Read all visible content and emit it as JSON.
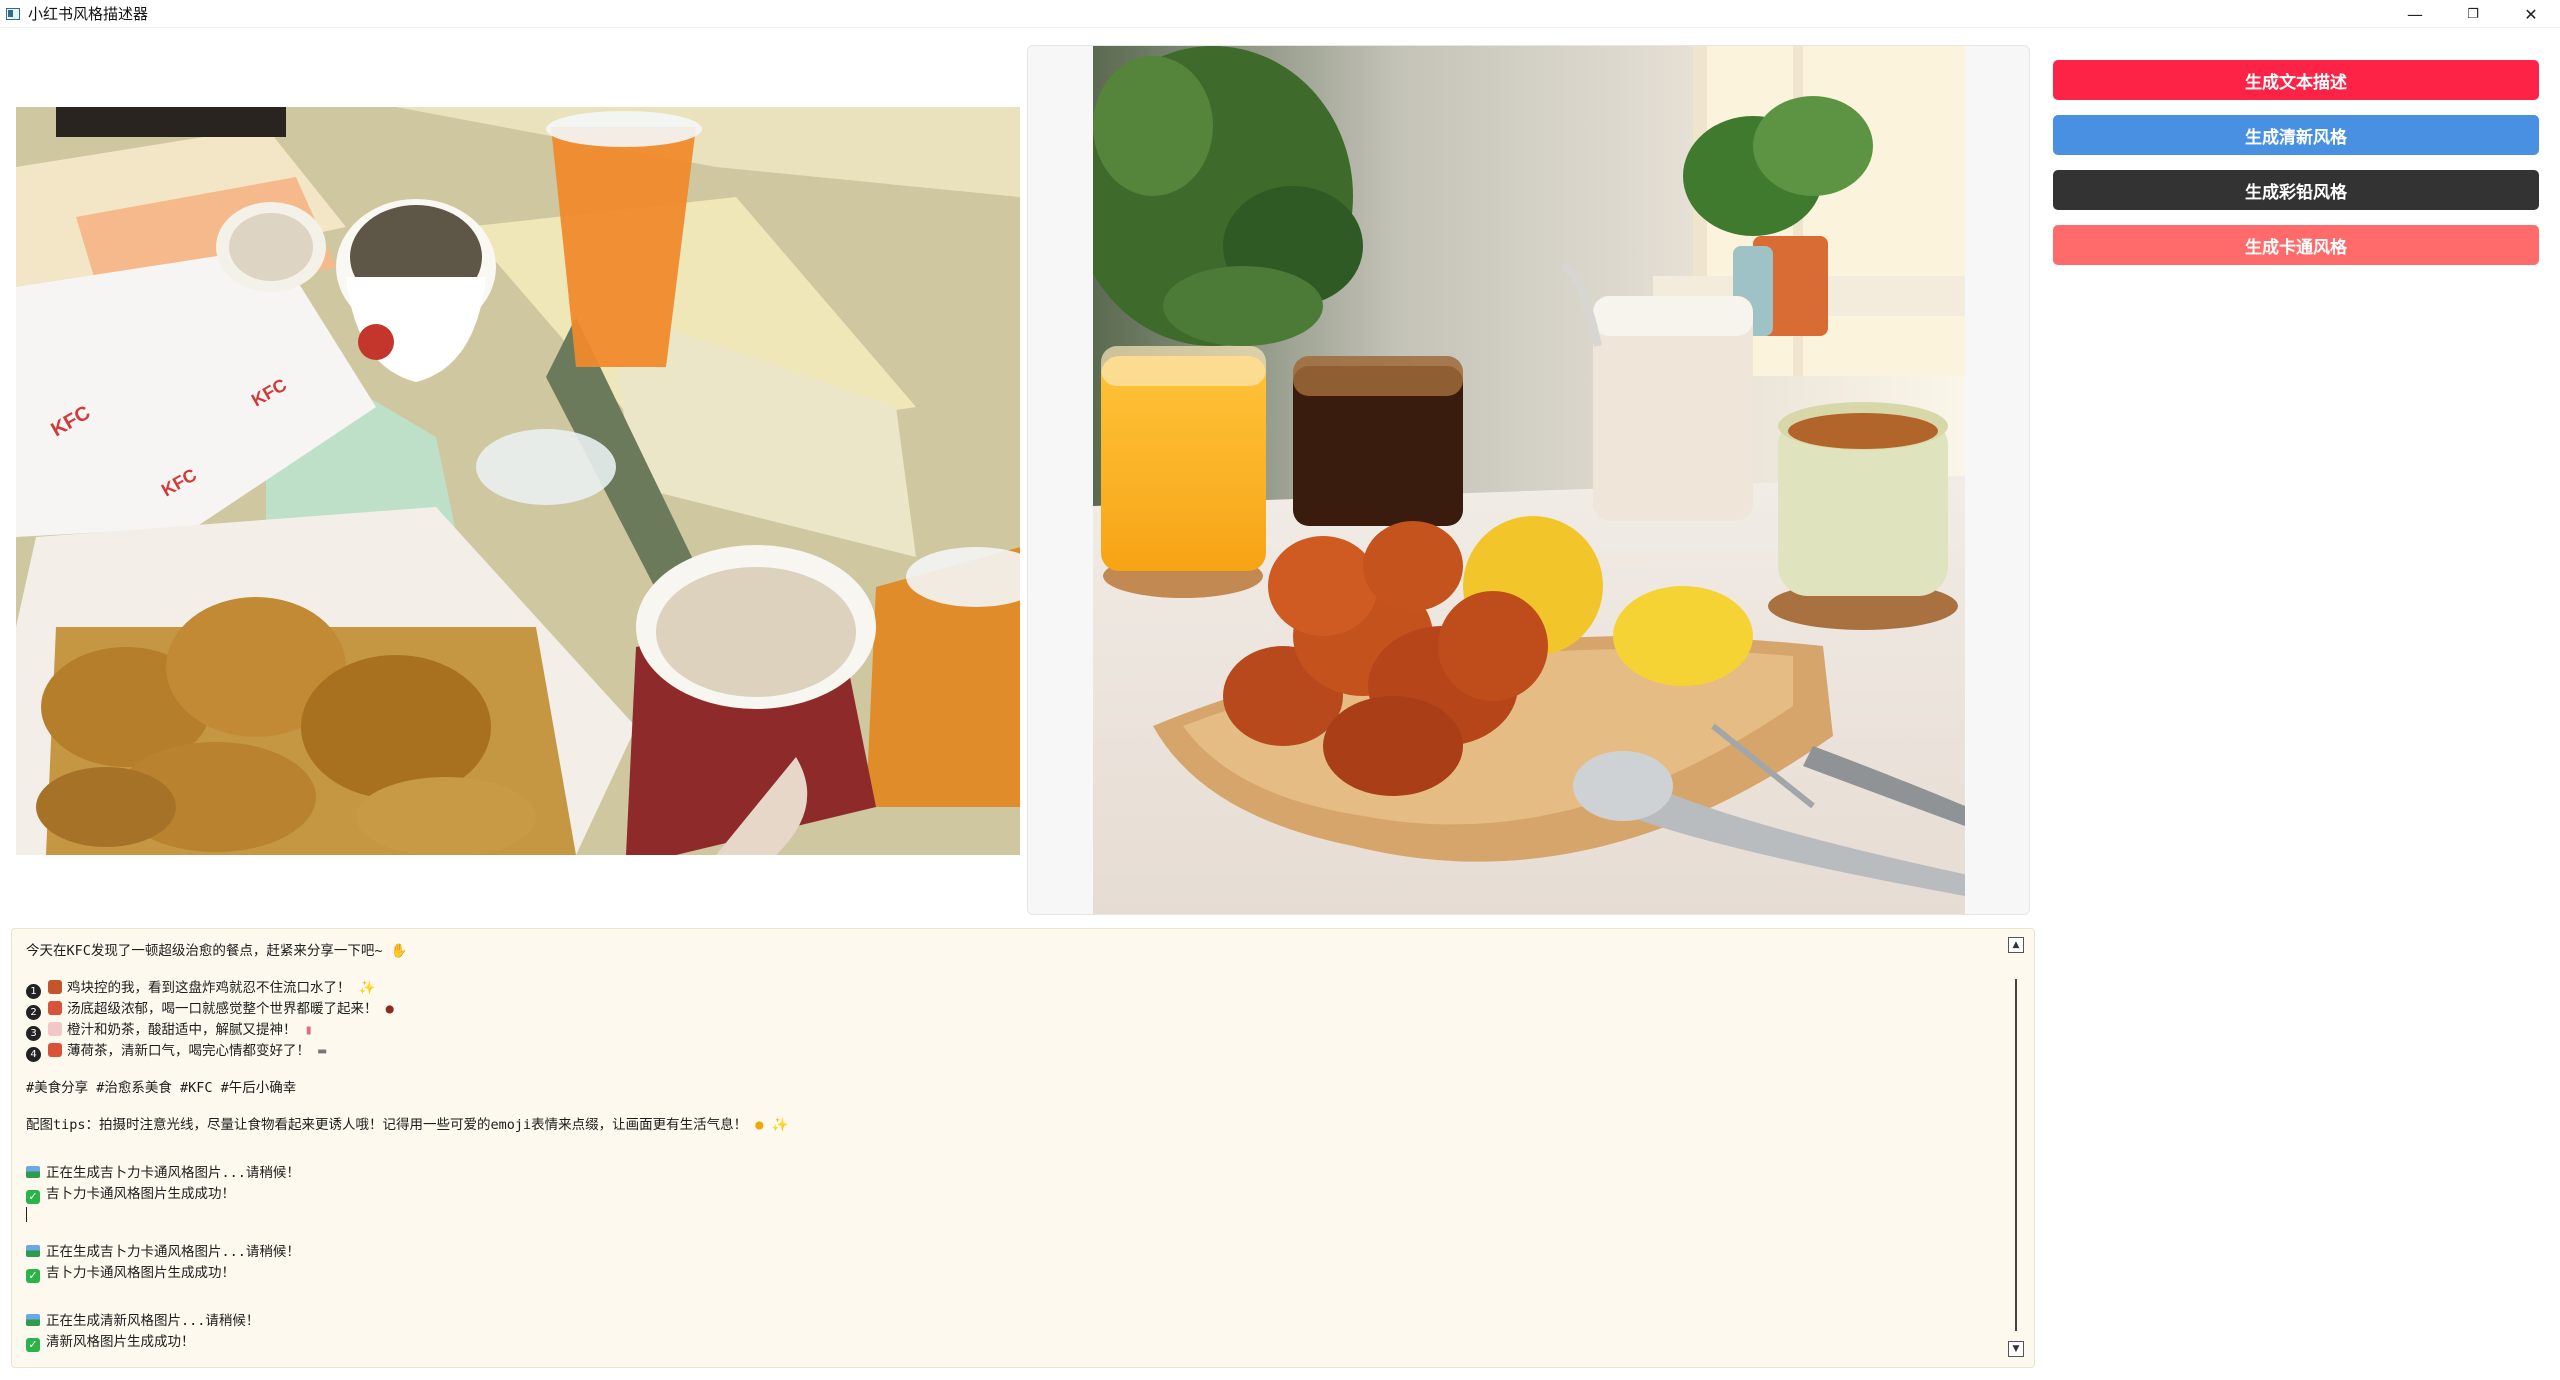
{
  "window": {
    "title": "小红书风格描述器",
    "minimize": "—",
    "maximize": "❐",
    "close": "✕"
  },
  "buttons": [
    {
      "label": "生成文本描述",
      "color": "#fd2346"
    },
    {
      "label": "生成清新风格",
      "color": "#4a90e2"
    },
    {
      "label": "生成彩铅风格",
      "color": "#333333"
    },
    {
      "label": "生成卡通风格",
      "color": "#ff6b6b"
    }
  ],
  "output": {
    "intro": "今天在KFC发现了一顿超级治愈的餐点，赶紧来分享一下吧~",
    "items": [
      {
        "num": "1",
        "text": "鸡块控的我，看到这盘炸鸡就忍不住流口水了！"
      },
      {
        "num": "2",
        "text": "汤底超级浓郁，喝一口就感觉整个世界都暖了起来！"
      },
      {
        "num": "3",
        "text": "橙汁和奶茶，酸甜适中，解腻又提神！"
      },
      {
        "num": "4",
        "text": "薄荷茶，清新口气，喝完心情都变好了！"
      }
    ],
    "tags": "#美食分享 #治愈系美食 #KFC #午后小确幸",
    "tips": "配图tips：拍摄时注意光线，尽量让食物看起来更诱人哦！记得用一些可爱的emoji表情来点缀，让画面更有生活气息！",
    "log": [
      {
        "pending": "正在生成吉卜力卡通风格图片...请稍候！",
        "done": "吉卜力卡通风格图片生成成功！"
      },
      {
        "pending": "正在生成吉卜力卡通风格图片...请稍候！",
        "done": "吉卜力卡通风格图片生成成功！"
      },
      {
        "pending": "正在生成清新风格图片...请稍候！",
        "done": "清新风格图片生成成功！"
      }
    ]
  },
  "scrollbar": {
    "up": "▲",
    "down": "▼"
  }
}
